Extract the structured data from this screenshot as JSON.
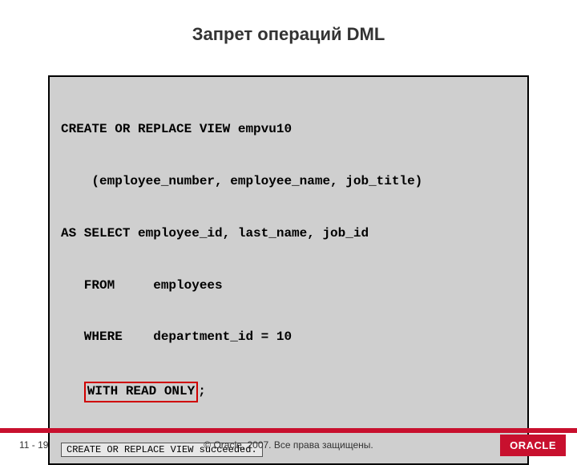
{
  "title": "Запрет операций DML",
  "code": {
    "line1": "CREATE OR REPLACE VIEW empvu10",
    "line2": "    (employee_number, employee_name, job_title)",
    "line3": "AS SELECT employee_id, last_name, job_id",
    "line4": "   FROM     employees",
    "line5": "   WHERE    department_id = 10",
    "line6_indent": "   ",
    "line6_highlight": "WITH READ ONLY",
    "line6_rest": ";"
  },
  "result_message": "CREATE OR REPLACE VIEW succeeded.",
  "footer": {
    "page": "11 - 19",
    "copyright": "© Oracle, 2007. Все права защищены.",
    "logo": "ORACLE"
  }
}
